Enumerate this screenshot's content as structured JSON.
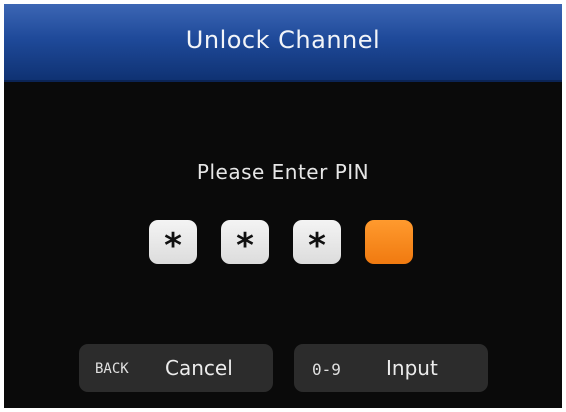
{
  "dialog": {
    "title": "Unlock Channel",
    "prompt": "Please Enter PIN"
  },
  "pin": {
    "digits": [
      "*",
      "*",
      "*",
      ""
    ],
    "active_color": "#f58a1f"
  },
  "buttons": {
    "cancel": {
      "key": "BACK",
      "label": "Cancel"
    },
    "input": {
      "key": "0-9",
      "label": "Input"
    }
  },
  "colors": {
    "title_bar": "#1f4a9a",
    "background": "#0a0a0a",
    "button": "#2c2c2c"
  }
}
